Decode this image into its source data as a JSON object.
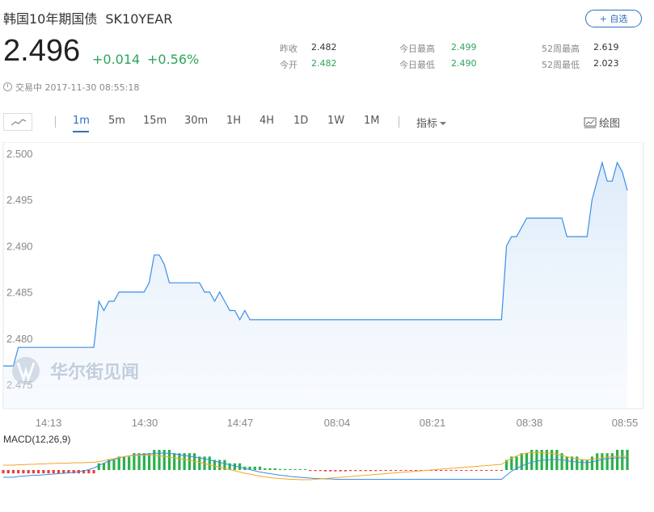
{
  "header": {
    "title": "韩国10年期国债",
    "symbol": "SK10YEAR",
    "watch_button": "+ 自选"
  },
  "quote": {
    "price": "2.496",
    "change": "+0.014",
    "change_pct": "+0.56%",
    "status": "交易中 2017-11-30 08:55:18"
  },
  "stats": {
    "prev_close_label": "昨收",
    "prev_close": "2.482",
    "open_label": "今开",
    "open": "2.482",
    "day_high_label": "今日最高",
    "day_high": "2.499",
    "day_low_label": "今日最低",
    "day_low": "2.490",
    "w52_high_label": "52周最高",
    "w52_high": "2.619",
    "w52_low_label": "52周最低",
    "w52_low": "2.023"
  },
  "toolbar": {
    "timeframes": [
      "1m",
      "5m",
      "15m",
      "30m",
      "1H",
      "4H",
      "1D",
      "1W",
      "1M"
    ],
    "active_timeframe": "1m",
    "indicator_label": "指标",
    "draw_label": "绘图"
  },
  "colors": {
    "accent": "#2d6fc0",
    "up": "#2aa65a",
    "line": "#3a8ee6",
    "macd_pos": "#2ab04a",
    "macd_neg": "#e8403a",
    "dea": "#f5a623"
  },
  "watermark": "华尔街见闻",
  "chart_data": {
    "type": "line",
    "ylim": [
      2.475,
      2.5
    ],
    "y_ticks": [
      "2.500",
      "2.495",
      "2.490",
      "2.485",
      "2.480",
      "2.475"
    ],
    "x_labels": [
      "14:13",
      "14:30",
      "14:47",
      "08:04",
      "08:21",
      "08:38",
      "08:55"
    ],
    "series": [
      {
        "values": [
          2.477,
          2.477,
          2.477,
          2.479,
          2.479,
          2.479,
          2.479,
          2.479,
          2.479,
          2.479,
          2.479,
          2.479,
          2.479,
          2.479,
          2.479,
          2.479,
          2.479,
          2.479,
          2.479,
          2.484,
          2.483,
          2.484,
          2.484,
          2.485,
          2.485,
          2.485,
          2.485,
          2.485,
          2.485,
          2.486,
          2.489,
          2.489,
          2.488,
          2.486,
          2.486,
          2.486,
          2.486,
          2.486,
          2.486,
          2.486,
          2.485,
          2.485,
          2.484,
          2.485,
          2.484,
          2.483,
          2.483,
          2.482,
          2.483,
          2.482,
          2.482,
          2.482,
          2.482,
          2.482,
          2.482,
          2.482,
          2.482,
          2.482,
          2.482,
          2.482,
          2.482,
          2.482,
          2.482,
          2.482,
          2.482,
          2.482,
          2.482,
          2.482,
          2.482,
          2.482,
          2.482,
          2.482,
          2.482,
          2.482,
          2.482,
          2.482,
          2.482,
          2.482,
          2.482,
          2.482,
          2.482,
          2.482,
          2.482,
          2.482,
          2.482,
          2.482,
          2.482,
          2.482,
          2.482,
          2.482,
          2.482,
          2.482,
          2.482,
          2.482,
          2.482,
          2.482,
          2.482,
          2.482,
          2.482,
          2.482,
          2.49,
          2.491,
          2.491,
          2.492,
          2.493,
          2.493,
          2.493,
          2.493,
          2.493,
          2.493,
          2.493,
          2.493,
          2.491,
          2.491,
          2.491,
          2.491,
          2.491,
          2.495,
          2.497,
          2.499,
          2.497,
          2.497,
          2.499,
          2.498,
          2.496
        ]
      }
    ],
    "macd": {
      "label": "MACD(12,26,9)",
      "hist": [
        -1,
        -1,
        -1,
        -1,
        -1,
        -1,
        -1,
        -1,
        -1,
        -1,
        -1,
        -1,
        -1,
        -1,
        -1,
        -1,
        -1,
        -1,
        -1,
        2,
        2,
        3,
        3,
        4,
        4,
        4,
        5,
        5,
        5,
        5,
        6,
        6,
        6,
        6,
        5,
        5,
        5,
        5,
        5,
        4,
        4,
        4,
        3,
        3,
        3,
        2,
        2,
        2,
        1,
        1,
        1,
        1,
        0.5,
        0.5,
        0.5,
        0.3,
        0.3,
        0.2,
        0.2,
        0.1,
        0.1,
        -0.3,
        -0.3,
        -0.3,
        -0.4,
        -0.4,
        -0.4,
        -0.4,
        -0.4,
        -0.3,
        -0.3,
        -0.3,
        -0.3,
        -0.3,
        -0.3,
        -0.2,
        -0.2,
        -0.2,
        -0.2,
        -0.2,
        -0.2,
        -0.1,
        -0.1,
        -0.1,
        -0.1,
        -0.1,
        -0.1,
        -0.1,
        -0.1,
        -0.1,
        -0.1,
        -0.1,
        -0.1,
        -0.1,
        -0.1,
        -0.1,
        -0.1,
        -0.1,
        -0.1,
        -0.1,
        3,
        4,
        4,
        5,
        5,
        6,
        6,
        6,
        6,
        6,
        6,
        5,
        4,
        4,
        4,
        3,
        3,
        4,
        5,
        5,
        5,
        5,
        6,
        6,
        6
      ],
      "dif": [
        1,
        1,
        1,
        1.2,
        1.3,
        1.4,
        1.5,
        1.5,
        1.6,
        1.7,
        1.8,
        1.9,
        2,
        2.1,
        2.2,
        2.4,
        2.6,
        2.9,
        3.3,
        3.9,
        4.5,
        5,
        5.4,
        5.8,
        6.1,
        6.3,
        6.5,
        6.6,
        6.7,
        6.8,
        6.9,
        7,
        7,
        6.9,
        6.8,
        6.6,
        6.4,
        6.2,
        6,
        5.8,
        5.6,
        5.3,
        5,
        4.7,
        4.4,
        4.1,
        3.8,
        3.5,
        3.2,
        2.9,
        2.6,
        2.3,
        2.1,
        1.9,
        1.7,
        1.5,
        1.4,
        1.2,
        1.1,
        1,
        0.9,
        0.8,
        0.7,
        0.7,
        0.6,
        0.6,
        0.5,
        0.5,
        0.5,
        0.5,
        0.5,
        0.5,
        0.5,
        0.5,
        0.5,
        0.5,
        0.5,
        0.5,
        0.5,
        0.5,
        0.5,
        0.5,
        0.5,
        0.5,
        0.5,
        0.5,
        0.5,
        0.5,
        0.5,
        0.5,
        0.5,
        0.5,
        0.5,
        0.5,
        0.5,
        0.5,
        0.5,
        0.5,
        0.5,
        0.5,
        1.5,
        2.5,
        3.2,
        3.8,
        4.3,
        4.7,
        5,
        5.2,
        5.3,
        5.4,
        5.4,
        5.3,
        5.1,
        4.9,
        4.8,
        4.7,
        4.6,
        4.8,
        5.1,
        5.4,
        5.6,
        5.7,
        5.8,
        5.8,
        5.8
      ],
      "dea": [
        4,
        4,
        4,
        4.1,
        4.1,
        4.2,
        4.2,
        4.3,
        4.3,
        4.4,
        4.4,
        4.5,
        4.5,
        4.5,
        4.6,
        4.6,
        4.6,
        4.7,
        4.7,
        4.9,
        5.1,
        5.4,
        5.6,
        5.9,
        6.1,
        6.3,
        6.4,
        6.5,
        6.5,
        6.5,
        6.4,
        6.3,
        6.2,
        6,
        5.8,
        5.6,
        5.4,
        5.2,
        4.9,
        4.7,
        4.4,
        4.1,
        3.8,
        3.5,
        3.2,
        2.9,
        2.6,
        2.3,
        2,
        1.8,
        1.5,
        1.3,
        1.1,
        0.9,
        0.8,
        0.7,
        0.6,
        0.5,
        0.5,
        0.4,
        0.4,
        0.4,
        0.5,
        0.6,
        0.7,
        0.8,
        0.9,
        1,
        1.1,
        1.2,
        1.3,
        1.4,
        1.5,
        1.6,
        1.7,
        1.8,
        1.9,
        2,
        2.1,
        2.2,
        2.3,
        2.4,
        2.5,
        2.6,
        2.7,
        2.8,
        2.9,
        3,
        3.1,
        3.2,
        3.3,
        3.4,
        3.5,
        3.6,
        3.7,
        3.8,
        3.9,
        4,
        4.1,
        4.2,
        5,
        5.7,
        6.3,
        6.7,
        7,
        7.1,
        7.2,
        7.1,
        7,
        6.9,
        6.7,
        6.4,
        6.1,
        5.8,
        5.6,
        5.4,
        5.3,
        5.4,
        5.6,
        5.8,
        6,
        6.1,
        6.2,
        6.2,
        6.2
      ]
    }
  }
}
